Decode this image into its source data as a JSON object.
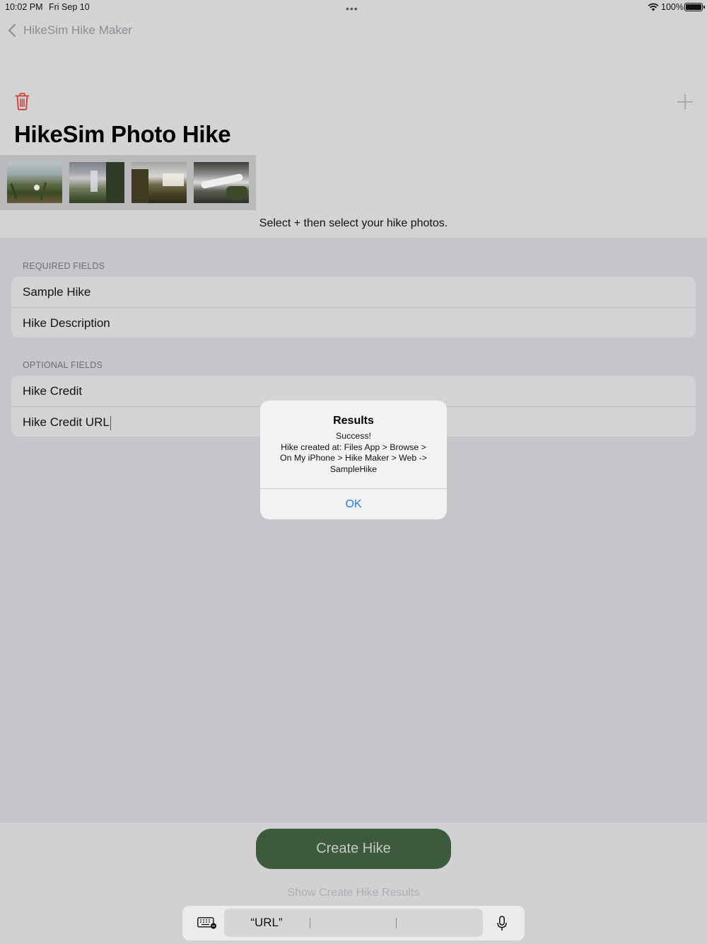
{
  "status_bar": {
    "time": "10:02 PM",
    "date": "Fri Sep 10",
    "multitask_dots": "•••",
    "battery_percent": "100%",
    "battery_level": 1.0
  },
  "nav": {
    "back_label": "HikeSim Hike Maker"
  },
  "toolbar": {
    "trash_icon": "trash-icon",
    "add_icon": "plus-icon"
  },
  "page": {
    "title": "HikeSim Photo Hike",
    "instruction": "Select + then select your hike photos."
  },
  "photos": [
    {
      "name": "photo-thumbnail-1"
    },
    {
      "name": "photo-thumbnail-2"
    },
    {
      "name": "photo-thumbnail-3"
    },
    {
      "name": "photo-thumbnail-4"
    }
  ],
  "required_section": {
    "header": "REQUIRED FIELDS",
    "fields": [
      "Sample Hike",
      "Hike Description"
    ]
  },
  "optional_section": {
    "header": "OPTIONAL FIELDS",
    "fields": [
      "Hike Credit",
      "Hike Credit URL"
    ]
  },
  "actions": {
    "create_label": "Create Hike",
    "show_results_label": "Show Create Hike Results"
  },
  "keyboard_bar": {
    "prediction_1": "“URL”",
    "prediction_2": "",
    "prediction_3": ""
  },
  "alert": {
    "title": "Results",
    "line_1": "Success!",
    "line_2": "Hike created at: Files App > Browse >",
    "line_3": "On My iPhone > Hike Maker > Web ->",
    "line_4": "SampleHike",
    "ok_label": "OK"
  },
  "colors": {
    "accent_blue": "#1a7cf0",
    "create_button": "#3d5a3c",
    "trash_red": "#d23a36"
  }
}
